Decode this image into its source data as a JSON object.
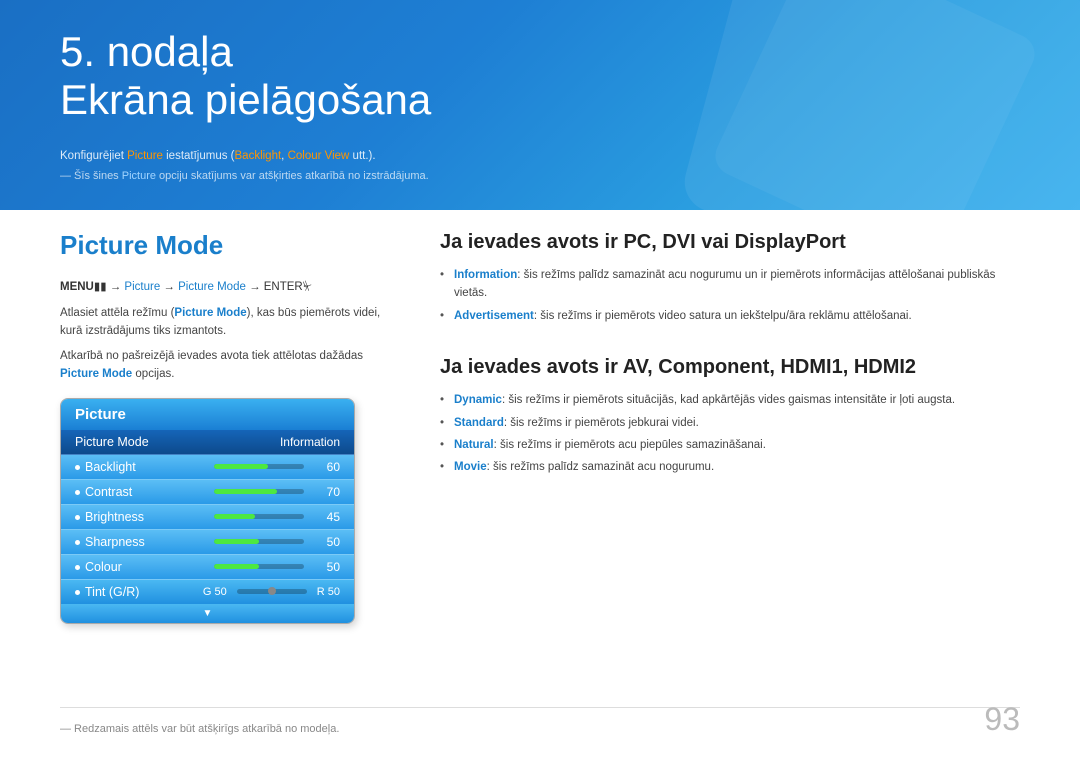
{
  "header": {
    "chapter": "5. nodaļa",
    "title": "Ekrāna pielāgošana",
    "subtitle_prefix": "Konfigurējiet ",
    "subtitle_link": "Picture",
    "subtitle_middle": " iestatījumus (",
    "subtitle_backlight": "Backlight",
    "subtitle_sep": ", ",
    "subtitle_colour": "Colour View",
    "subtitle_suffix": " utt.).",
    "note_prefix": "— Šīs šines ",
    "note_link": "Picture",
    "note_suffix": " opciju skatījums var atšķirties atkarībā no izstrādājuma."
  },
  "left": {
    "section_title": "Picture Mode",
    "menu_path": "MENU  → Picture → Picture Mode → ENTER",
    "desc1_prefix": "Atlasiet attēla režīmu (",
    "desc1_link": "Picture Mode",
    "desc1_suffix": "), kas būs piemērots videi, kurā izstrādājums tiks izmantots.",
    "desc2_prefix": "Atkarībā no pašreizējā ievades avota tiek attēlotas dažādas ",
    "desc2_link": "Picture Mode",
    "desc2_suffix": " opcijas.",
    "picture_ui": {
      "header": "Picture",
      "rows": [
        {
          "label": "Picture Mode",
          "value": "Information",
          "type": "select"
        },
        {
          "label": "Backlight",
          "fill": 60,
          "value": "60",
          "type": "slider"
        },
        {
          "label": "Contrast",
          "fill": 70,
          "value": "70",
          "type": "slider"
        },
        {
          "label": "Brightness",
          "fill": 45,
          "value": "45",
          "type": "slider"
        },
        {
          "label": "Sharpness",
          "fill": 50,
          "value": "50",
          "type": "slider"
        },
        {
          "label": "Colour",
          "fill": 50,
          "value": "50",
          "type": "slider"
        },
        {
          "label": "Tint (G/R)",
          "g_value": "G 50",
          "r_value": "R 50",
          "type": "tint"
        }
      ]
    }
  },
  "right": {
    "section1": {
      "heading": "Ja ievades avots ir PC, DVI vai DisplayPort",
      "items": [
        {
          "term": "Information",
          "term_color": "blue",
          "text": ": šis režīms palīdz samazināt acu nogurumu un ir piemērots informācijas attēlošanai publiskās vietās."
        },
        {
          "term": "Advertisement",
          "term_color": "blue",
          "text": ": šis režīms ir piemērots video satura un iekštelpu/āra reklāmu attēlošanai."
        }
      ]
    },
    "section2": {
      "heading": "Ja ievades avots ir AV, Component, HDMI1, HDMI2",
      "items": [
        {
          "term": "Dynamic",
          "term_color": "blue",
          "text": ": šis režīms ir piemērots situācijās, kad apkārtējās vides gaismas intensitāte ir ļoti augsta."
        },
        {
          "term": "Standard",
          "term_color": "blue",
          "text": ": šis režīms ir piemērots jebkurai videi."
        },
        {
          "term": "Natural",
          "term_color": "blue",
          "text": ": šis režīms ir piemērots acu piepūles samazināšanai."
        },
        {
          "term": "Movie",
          "term_color": "blue",
          "text": ": šis režīms palīdz samazināt acu nogurumu."
        }
      ]
    }
  },
  "footer": {
    "note": "— Redzamais attēls var būt atšķirīgs atkarībā no modeļa."
  },
  "page_number": "93"
}
